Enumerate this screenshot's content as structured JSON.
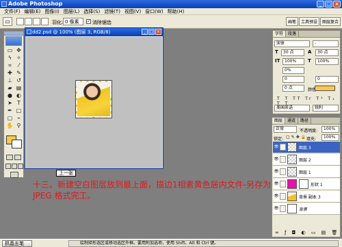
{
  "app": {
    "title": "Adobe Photoshop"
  },
  "menus": [
    "文件(F)",
    "编辑(E)",
    "图像(I)",
    "图层(L)",
    "选择(S)",
    "滤镜(T)",
    "视图(V)",
    "窗口(W)",
    "帮助(H)"
  ],
  "options": {
    "feather_label": "羽化:",
    "feather_value": "0 像素",
    "antialias_label": "消除锯齿"
  },
  "panel_well": [
    "画笔",
    "工具预设",
    "图层复合"
  ],
  "document": {
    "title": "dd2.psd @ 100% (图层 3, RGB/8)"
  },
  "zoom_label": "上一张",
  "caption": "十三、新建空白图层放到最上面，描边1相素黄色居内文件-另存为 JPEG 格式完工。",
  "char_panel": {
    "tabs": [
      "字符",
      "段落"
    ],
    "font_family": "宋体",
    "font_style": "-",
    "size": "30 点",
    "leading": "30 点",
    "scale_v": "100%",
    "scale_h": "100%",
    "tracking_a": "0%",
    "tracking_b": "0",
    "kerning": "0",
    "baseline": "0 点",
    "color_label": "颜色:",
    "language": "美国英语",
    "aa": "锐利"
  },
  "layer_panel": {
    "tabs": [
      "图层",
      "通道",
      "路径"
    ],
    "blend_mode": "正常",
    "opacity_label": "不透明度:",
    "opacity_value": "100%",
    "lock_label": "锁定:",
    "fill_label": "填充:",
    "fill_value": "100%",
    "layers": [
      {
        "name": "图层 3"
      },
      {
        "name": "图层 2"
      },
      {
        "name": "图层 1"
      },
      {
        "name": "形状 1"
      },
      {
        "name": "背景 副本 3"
      },
      {
        "name": "背景"
      }
    ]
  },
  "taskbar": {
    "start": "抓晶五笔",
    "status": "绘制矩形选区或移动选区外框。要用附加选项，使用 Shift、Alt 和 Ctrl 键。"
  },
  "colors": {
    "foreground": "#f9c94b",
    "background": "#ffffff",
    "caption": "#e0191d"
  }
}
